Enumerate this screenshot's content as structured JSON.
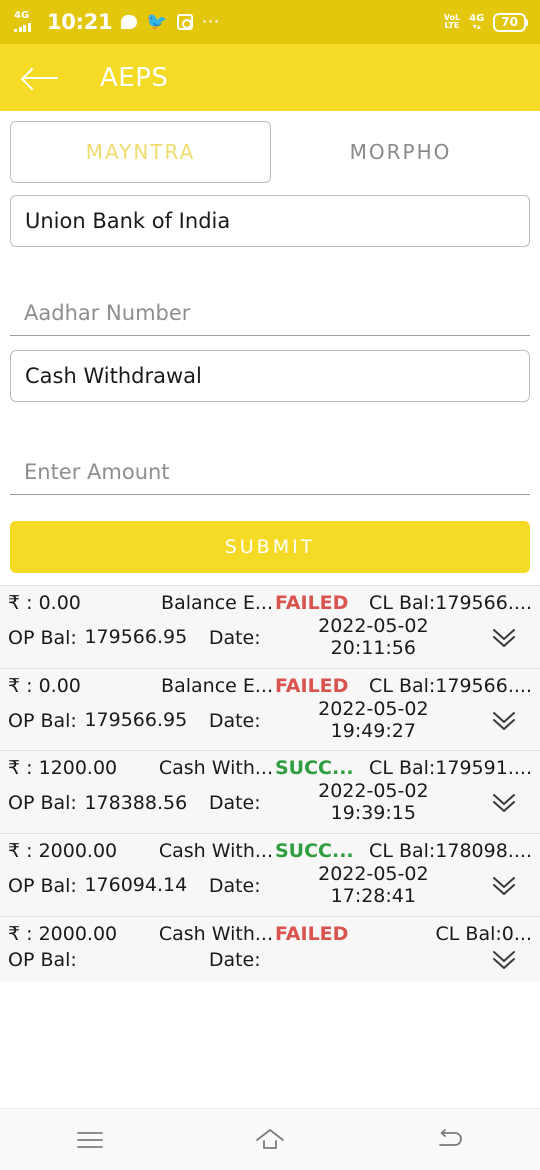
{
  "status_bar": {
    "network_label": "4G",
    "time": "10:21",
    "volte_top": "VoL",
    "volte_bottom": "LTE",
    "network_right": "4G",
    "battery": "70",
    "icons": [
      "signal-icon",
      "chat-bubble-icon",
      "twitter-icon",
      "app-icon",
      "more-dots-icon"
    ],
    "bg_color": "#e3c70c"
  },
  "app_bar": {
    "back_label": "back-arrow-icon",
    "title": "AEPS",
    "bg_color": "#f5db25"
  },
  "tabs": [
    {
      "label": "MAYNTRA",
      "active": true
    },
    {
      "label": "MORPHO",
      "active": false
    }
  ],
  "form": {
    "bank": {
      "value": "Union Bank of India"
    },
    "aadhar": {
      "placeholder": "Aadhar Number",
      "value": ""
    },
    "transaction_type": {
      "value": "Cash Withdrawal"
    },
    "amount": {
      "placeholder": "Enter Amount",
      "value": ""
    },
    "submit_label": "SUBMIT"
  },
  "colors": {
    "accent": "#f5db25",
    "accent_dark": "#e3c70c",
    "tab_active_text": "#f0dc6e",
    "failed": "#d9534f",
    "success": "#2e9e3e"
  },
  "transactions": {
    "labels": {
      "op_bal": "OP Bal:",
      "date": "Date:"
    },
    "rows": [
      {
        "amount": "₹ : 0.00",
        "type": "Balance E...",
        "status": "FAILED",
        "status_kind": "failed",
        "cl_bal": "CL Bal:179566....",
        "op_bal": "179566.95",
        "date": "2022-05-02",
        "time": "20:11:56"
      },
      {
        "amount": "₹ : 0.00",
        "type": "Balance E...",
        "status": "FAILED",
        "status_kind": "failed",
        "cl_bal": "CL Bal:179566....",
        "op_bal": "179566.95",
        "date": "2022-05-02",
        "time": "19:49:27"
      },
      {
        "amount": "₹ : 1200.00",
        "type": "Cash With...",
        "status": "SUCC...",
        "status_kind": "success",
        "cl_bal": "CL Bal:179591....",
        "op_bal": "178388.56",
        "date": "2022-05-02",
        "time": "19:39:15"
      },
      {
        "amount": "₹ : 2000.00",
        "type": "Cash With...",
        "status": "SUCC...",
        "status_kind": "success",
        "cl_bal": "CL Bal:178098....",
        "op_bal": "176094.14",
        "date": "2022-05-02",
        "time": "17:28:41"
      },
      {
        "amount": "₹ : 2000.00",
        "type": "Cash With...",
        "status": "FAILED",
        "status_kind": "failed",
        "cl_bal": "CL Bal:0...",
        "op_bal": "",
        "date": "",
        "time": ""
      }
    ],
    "expand_icon": "chevron-double-down-icon"
  },
  "nav_bar": {
    "recents_label": "recents-icon",
    "home_label": "home-icon",
    "back_label": "back-icon"
  }
}
